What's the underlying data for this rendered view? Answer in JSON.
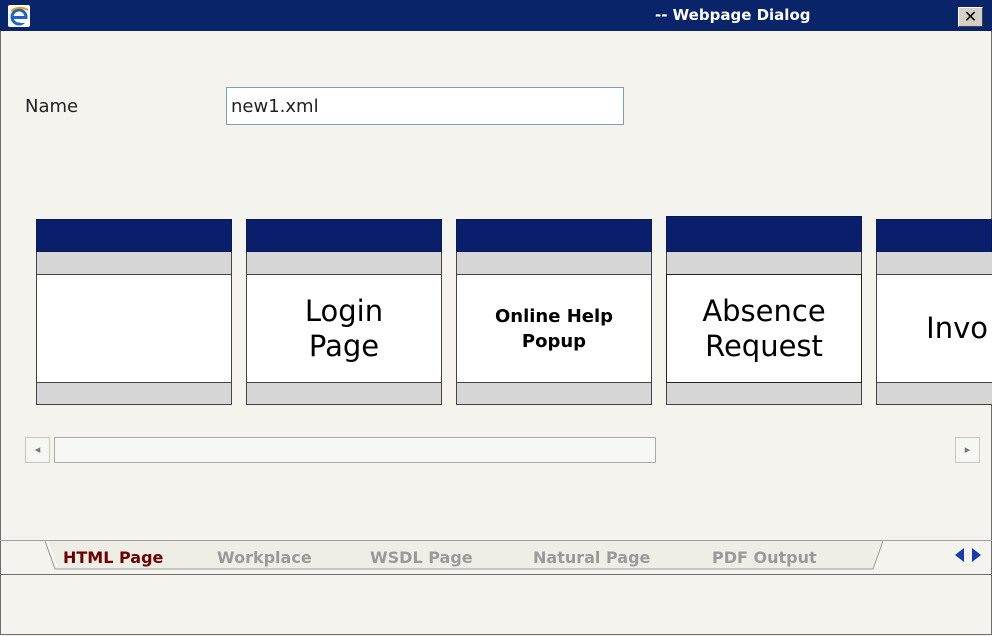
{
  "window": {
    "title": "-- Webpage Dialog",
    "close_label": "✕",
    "icon": "ie-icon"
  },
  "form": {
    "name_label": "Name",
    "name_value": "new1.xml"
  },
  "tiles": [
    {
      "label_lines": [
        "",
        ""
      ],
      "style": "large"
    },
    {
      "label_lines": [
        "Login",
        "Page"
      ],
      "style": "large"
    },
    {
      "label_lines": [
        "Online Help",
        "Popup"
      ],
      "style": "bold"
    },
    {
      "label_lines": [
        "Absence",
        "Request"
      ],
      "style": "large"
    },
    {
      "label_lines": [
        "Invo",
        ""
      ],
      "style": "large"
    }
  ],
  "scrollbar": {
    "left_arrow": "◂",
    "right_arrow": "▸"
  },
  "tabs": [
    {
      "label": "HTML Page",
      "active": true
    },
    {
      "label": "Workplace",
      "active": false
    },
    {
      "label": "WSDL Page",
      "active": false
    },
    {
      "label": "Natural Page",
      "active": false
    },
    {
      "label": "PDF Output",
      "active": false
    }
  ],
  "colors": {
    "titlebar": "#0a246a",
    "tile_header": "#0a1f6c",
    "active_tab": "#6a0000",
    "inactive_tab": "#9a9a9a",
    "nav_arrows": "#1a3aa8"
  }
}
